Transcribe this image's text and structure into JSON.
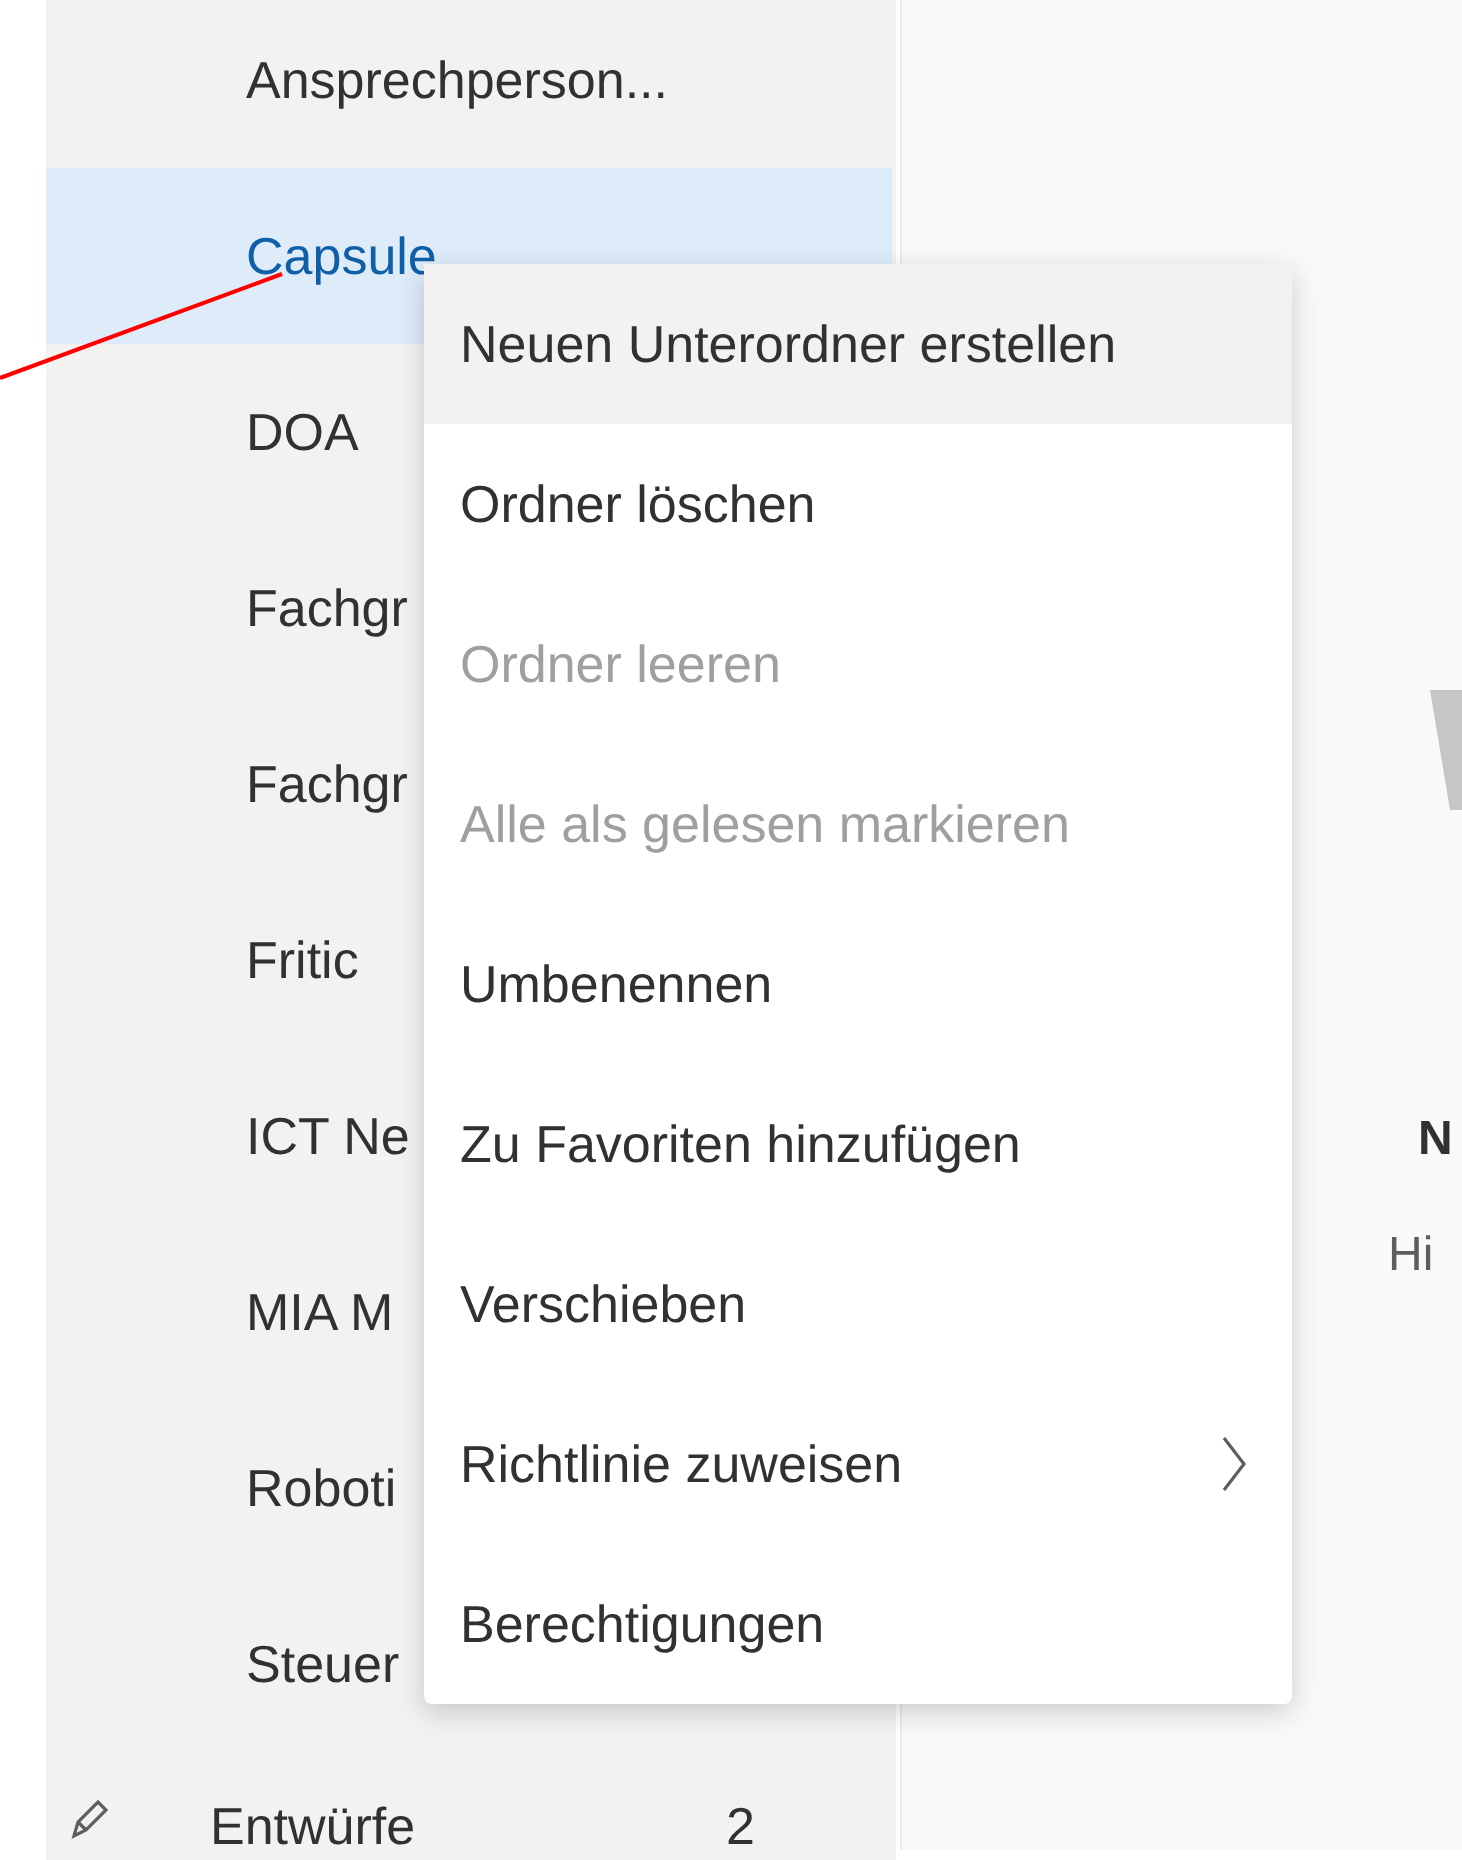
{
  "sidebar": {
    "folders": [
      {
        "label": "Ansprechperson...",
        "selected": false
      },
      {
        "label": "Capsule",
        "selected": true
      },
      {
        "label": "DOA",
        "selected": false
      },
      {
        "label": "Fachgr",
        "selected": false
      },
      {
        "label": "Fachgr",
        "selected": false
      },
      {
        "label": "Fritic",
        "selected": false
      },
      {
        "label": "ICT Ne",
        "selected": false
      },
      {
        "label": "MIA M",
        "selected": false
      },
      {
        "label": "Roboti",
        "selected": false
      },
      {
        "label": "Steuer",
        "selected": false
      }
    ],
    "drafts": {
      "label": "Entwürfe",
      "count": "2"
    }
  },
  "context_menu": {
    "items": [
      {
        "label": "Neuen Unterordner erstellen",
        "selected": true,
        "disabled": false,
        "submenu": false
      },
      {
        "label": "Ordner löschen",
        "selected": false,
        "disabled": false,
        "submenu": false
      },
      {
        "label": "Ordner leeren",
        "selected": false,
        "disabled": true,
        "submenu": false
      },
      {
        "label": "Alle als gelesen markieren",
        "selected": false,
        "disabled": true,
        "submenu": false
      },
      {
        "label": "Umbenennen",
        "selected": false,
        "disabled": false,
        "submenu": false
      },
      {
        "label": "Zu Favoriten hinzufügen",
        "selected": false,
        "disabled": false,
        "submenu": false
      },
      {
        "label": "Verschieben",
        "selected": false,
        "disabled": false,
        "submenu": false
      },
      {
        "label": "Richtlinie zuweisen",
        "selected": false,
        "disabled": false,
        "submenu": true
      },
      {
        "label": "Berechtigungen",
        "selected": false,
        "disabled": false,
        "submenu": false
      }
    ]
  },
  "reading_pane": {
    "title": "N",
    "subtitle": "Hi"
  }
}
